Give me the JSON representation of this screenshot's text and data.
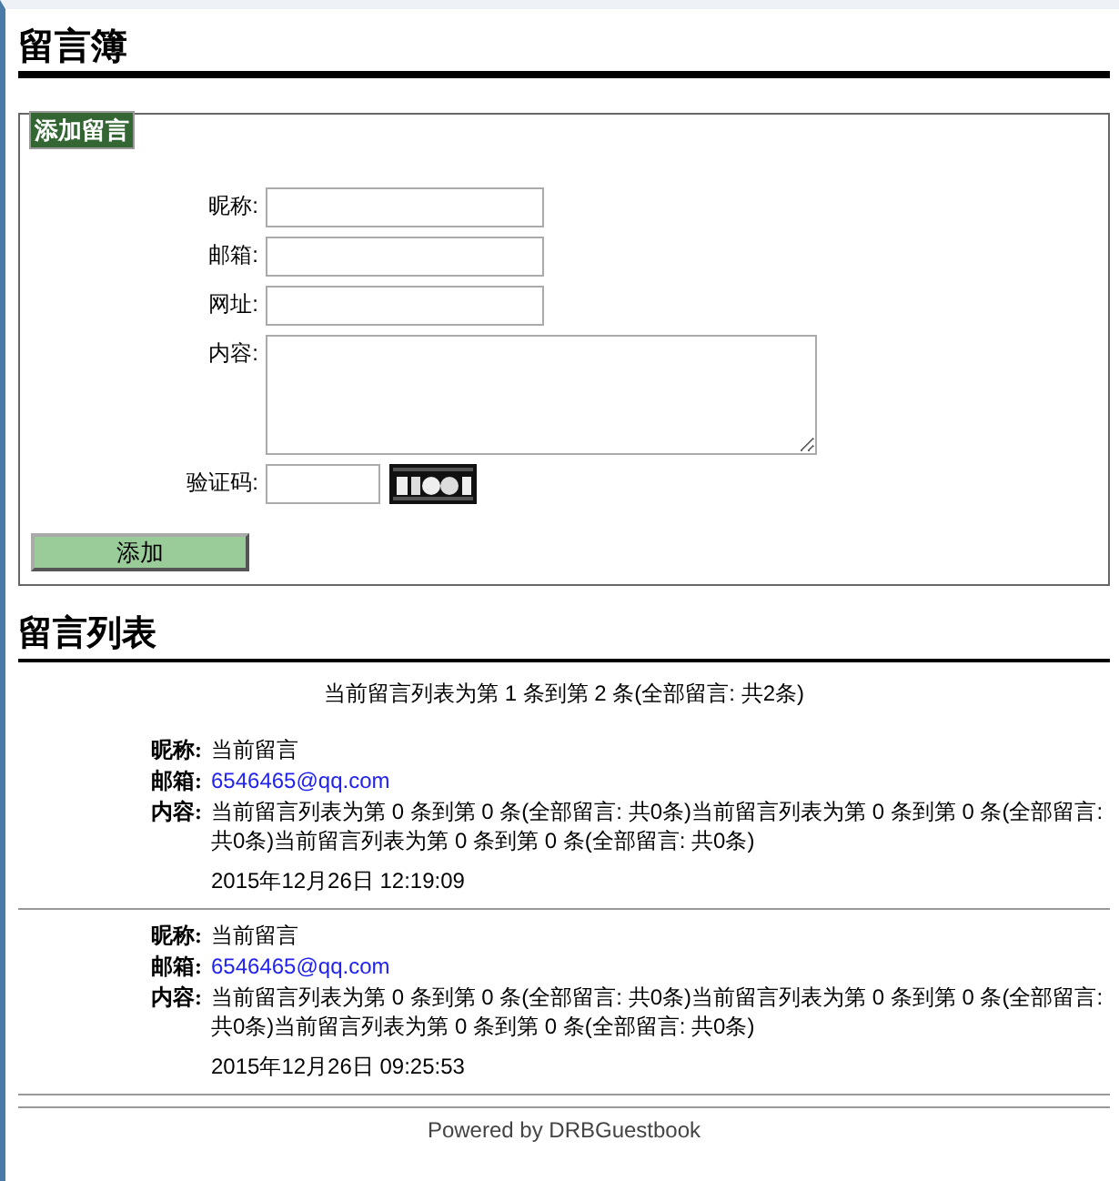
{
  "title": "留言簿",
  "form": {
    "legend": "添加留言",
    "fields": [
      {
        "label": "昵称:",
        "kind": "input"
      },
      {
        "label": "邮箱:",
        "kind": "input"
      },
      {
        "label": "网址:",
        "kind": "input"
      },
      {
        "label": "内容:",
        "kind": "textarea"
      },
      {
        "label": "验证码:",
        "kind": "captcha"
      }
    ],
    "submit": "添加"
  },
  "list": {
    "title": "留言列表",
    "summary": "当前留言列表为第 1 条到第 2 条(全部留言: 共2条)",
    "entries": [
      {
        "nick_label": "昵称:",
        "nick": "当前留言",
        "email_label": "邮箱:",
        "email": "6546465@qq.com",
        "content_label": "内容:",
        "content": "当前留言列表为第 0 条到第 0 条(全部留言: 共0条)当前留言列表为第 0 条到第 0 条(全部留言: 共0条)当前留言列表为第 0 条到第 0 条(全部留言: 共0条)",
        "time": "2015年12月26日 12:19:09"
      },
      {
        "nick_label": "昵称:",
        "nick": "当前留言",
        "email_label": "邮箱:",
        "email": "6546465@qq.com",
        "content_label": "内容:",
        "content": "当前留言列表为第 0 条到第 0 条(全部留言: 共0条)当前留言列表为第 0 条到第 0 条(全部留言: 共0条)当前留言列表为第 0 条到第 0 条(全部留言: 共0条)",
        "time": "2015年12月26日 09:25:53"
      }
    ]
  },
  "footer": "Powered by DRBGuestbook"
}
